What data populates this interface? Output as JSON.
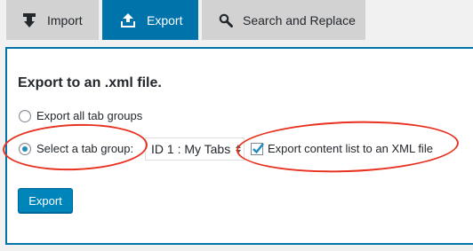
{
  "tabs": [
    {
      "label": "Import",
      "icon": "download-icon",
      "active": false
    },
    {
      "label": "Export",
      "icon": "upload-icon",
      "active": true
    },
    {
      "label": "Search and Replace",
      "icon": "search-icon",
      "active": false
    }
  ],
  "panel": {
    "title": "Export to an .xml file.",
    "option_all_label": "Export all tab groups",
    "option_select_label": "Select a tab group:",
    "selected_option": "select",
    "tab_group_select_value": "ID 1 : My Tabs",
    "content_list_checkbox_label": "Export content list to an XML file",
    "content_list_checked": true,
    "export_button_label": "Export"
  },
  "colors": {
    "accent": "#0073aa",
    "button": "#0085ba",
    "tab_inactive": "#d2d2d2",
    "annotation": "#e8311f"
  }
}
